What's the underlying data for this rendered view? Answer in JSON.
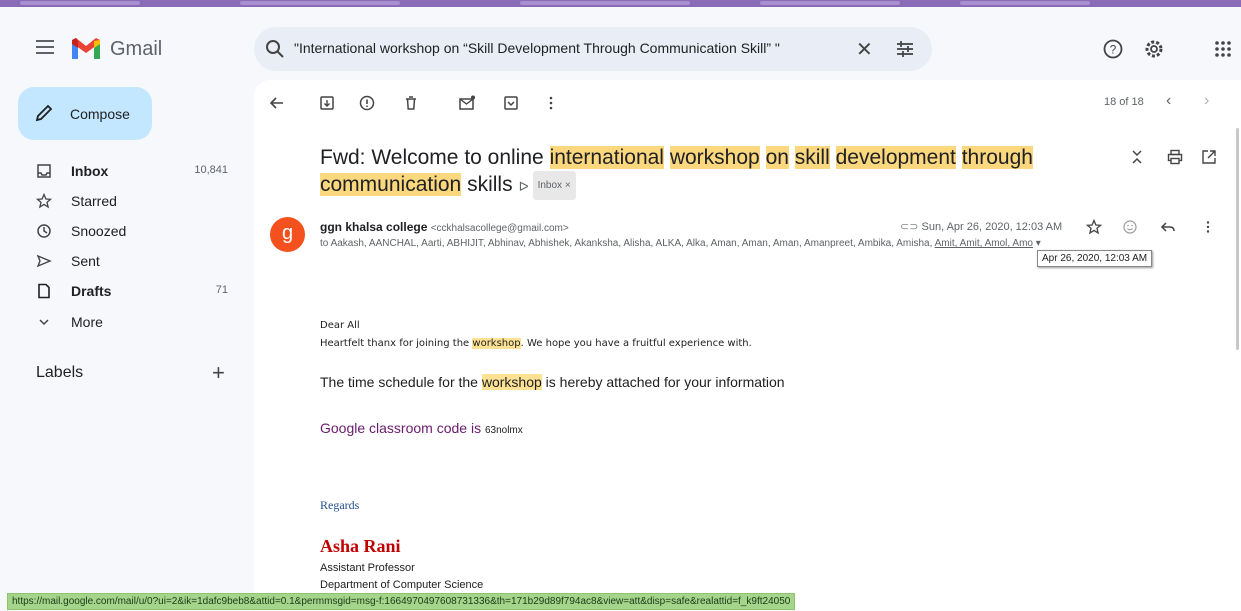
{
  "app": {
    "brand": "Gmail"
  },
  "search": {
    "query": "\"International workshop on “Skill Development Through Communication Skill” \"",
    "clear_label": "✕"
  },
  "sidebar": {
    "compose_label": "Compose",
    "items": [
      {
        "label": "Inbox",
        "count": "10,841",
        "icon": "inbox-icon"
      },
      {
        "label": "Starred",
        "count": "",
        "icon": "star-icon"
      },
      {
        "label": "Snoozed",
        "count": "",
        "icon": "clock-icon"
      },
      {
        "label": "Sent",
        "count": "",
        "icon": "send-icon"
      },
      {
        "label": "Drafts",
        "count": "71",
        "icon": "draft-icon"
      },
      {
        "label": "More",
        "count": "",
        "icon": "chevron-down-icon"
      }
    ],
    "labels_heading": "Labels",
    "labels_add": "+"
  },
  "toolbar": {
    "pager": "18 of 18"
  },
  "email": {
    "subject_prefix": "Fwd: Welcome to online",
    "subject_words": [
      "international",
      "workshop",
      "on",
      "skill",
      "development",
      "through",
      "communication"
    ],
    "subject_suffix": "skills",
    "label_badge": "Inbox ×",
    "sender_name": "ggn khalsa college",
    "sender_email": "<cckhalsacollege@gmail.com>",
    "avatar_letter": "g",
    "recipients_prefix": "to Aakash, AANCHAL, Aarti, ABHIJIT, Abhinav, Abhishek, Akanksha, Alisha, ALKA, Alka, Aman, Aman, Aman, Amanpreet, Ambika, Amisha, ",
    "recipients_tail": "Amit, Amit, Amol, Amo",
    "date": "Sun, Apr 26, 2020, 12:03 AM",
    "tooltip": "Apr 26, 2020, 12:03 AM",
    "body": {
      "greeting": "Dear All",
      "line1_a": "Heartfelt thanx for joining the ",
      "line1_hl": "workshop",
      "line1_b": ". We hope you have a fruitful experience with.",
      "line2_a": "The time schedule for the ",
      "line2_hl": "workshop",
      "line2_b": " is hereby attached for your information",
      "gc_label": "Google classroom code is ",
      "gc_code": "63nolmx",
      "regards": "Regards",
      "sig_name": "Asha Rani",
      "sig_title": "Assistant Professor",
      "sig_dept": "Department of Computer Science"
    }
  },
  "status_url": "https://mail.google.com/mail/u/0?ui=2&ik=1dafc9beb8&attid=0.1&permmsgid=msg-f:1664970497608731336&th=171b29d89f794ac8&view=att&disp=safe&realattid=f_k9ft24050",
  "colors": {
    "compose_bg": "#c2e7ff",
    "highlight": "#fbd77e",
    "avatar": "#f4511e",
    "signature": "#c00000"
  }
}
